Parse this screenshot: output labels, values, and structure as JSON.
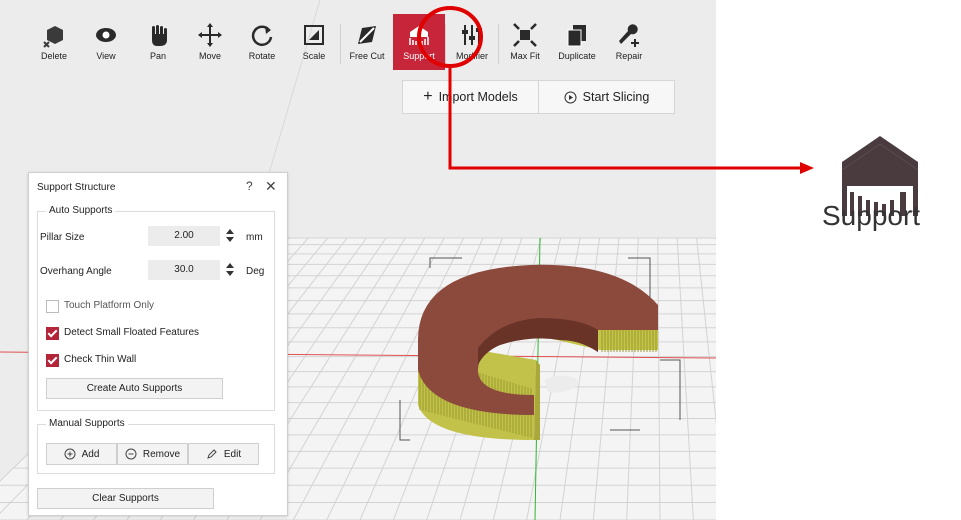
{
  "toolbar": {
    "tools": [
      {
        "label": "Delete",
        "icon": "cube-x-icon"
      },
      {
        "label": "View",
        "icon": "eye-icon"
      },
      {
        "label": "Pan",
        "icon": "hand-icon"
      },
      {
        "label": "Move",
        "icon": "move-arrows-icon"
      },
      {
        "label": "Rotate",
        "icon": "rotate-icon"
      },
      {
        "label": "Scale",
        "icon": "scale-icon"
      },
      {
        "label": "Free Cut",
        "icon": "free-cut-icon"
      },
      {
        "label": "Support",
        "icon": "support-icon",
        "active": true
      },
      {
        "label": "Modifier",
        "icon": "modifier-sliders-icon"
      },
      {
        "label": "Max Fit",
        "icon": "max-fit-icon"
      },
      {
        "label": "Duplicate",
        "icon": "duplicate-icon"
      },
      {
        "label": "Repair",
        "icon": "wrench-icon"
      }
    ]
  },
  "action_bar": {
    "import_label": "Import Models",
    "slice_label": "Start Slicing"
  },
  "panel": {
    "title": "Support Structure",
    "help": "?",
    "close": "✕",
    "auto": {
      "title": "Auto Supports",
      "pillar_label": "Pillar Size",
      "pillar_value": "2.00",
      "pillar_unit": "mm",
      "overhang_label": "Overhang Angle",
      "overhang_value": "30.0",
      "overhang_unit": "Deg",
      "touch_label": "Touch Platform Only",
      "touch_checked": false,
      "detect_label": "Detect Small Floated Features",
      "detect_checked": true,
      "thin_label": "Check Thin Wall",
      "thin_checked": true,
      "create_label": "Create Auto Supports"
    },
    "manual": {
      "title": "Manual Supports",
      "add_label": "Add",
      "remove_label": "Remove",
      "edit_label": "Edit"
    },
    "clear_label": "Clear Supports"
  },
  "callout": {
    "zoom_label": "Support",
    "icon": "support-icon"
  },
  "colors": {
    "accent": "#c7263a",
    "highlight": "#e00000",
    "model": "#8c4a3c",
    "support": "#c9c94a"
  }
}
